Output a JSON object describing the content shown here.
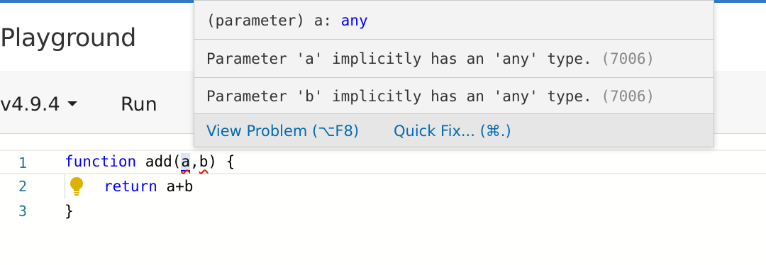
{
  "header": {
    "title": "Playground"
  },
  "toolbar": {
    "version": "v4.9.4",
    "run_label": "Run"
  },
  "editor": {
    "lines": [
      {
        "number": "1",
        "keyword": "function",
        "text_a": " add(",
        "param_a": "a",
        "comma": ",",
        "param_b": "b",
        "text_b": ") {"
      },
      {
        "number": "2",
        "keyword": "return",
        "rest": " a+b"
      },
      {
        "number": "3",
        "text": "}"
      }
    ]
  },
  "hover": {
    "signature_prefix": "(parameter) a: ",
    "signature_type": "any",
    "problems": [
      {
        "message": "Parameter 'a' implicitly has an 'any' type. ",
        "code": "(7006)"
      },
      {
        "message": "Parameter 'b' implicitly has an 'any' type. ",
        "code": "(7006)"
      }
    ],
    "actions": {
      "view_problem": "View Problem (⌥F8)",
      "quick_fix": "Quick Fix... (⌘.)"
    }
  },
  "colors": {
    "accent": "#3178c6",
    "keyword": "#0000ff",
    "error": "#e51400",
    "link": "#006ab1",
    "bulb": "#ddb100"
  },
  "icons": {
    "lightbulb": "lightbulb-icon",
    "dropdown": "chevron-down-icon"
  }
}
